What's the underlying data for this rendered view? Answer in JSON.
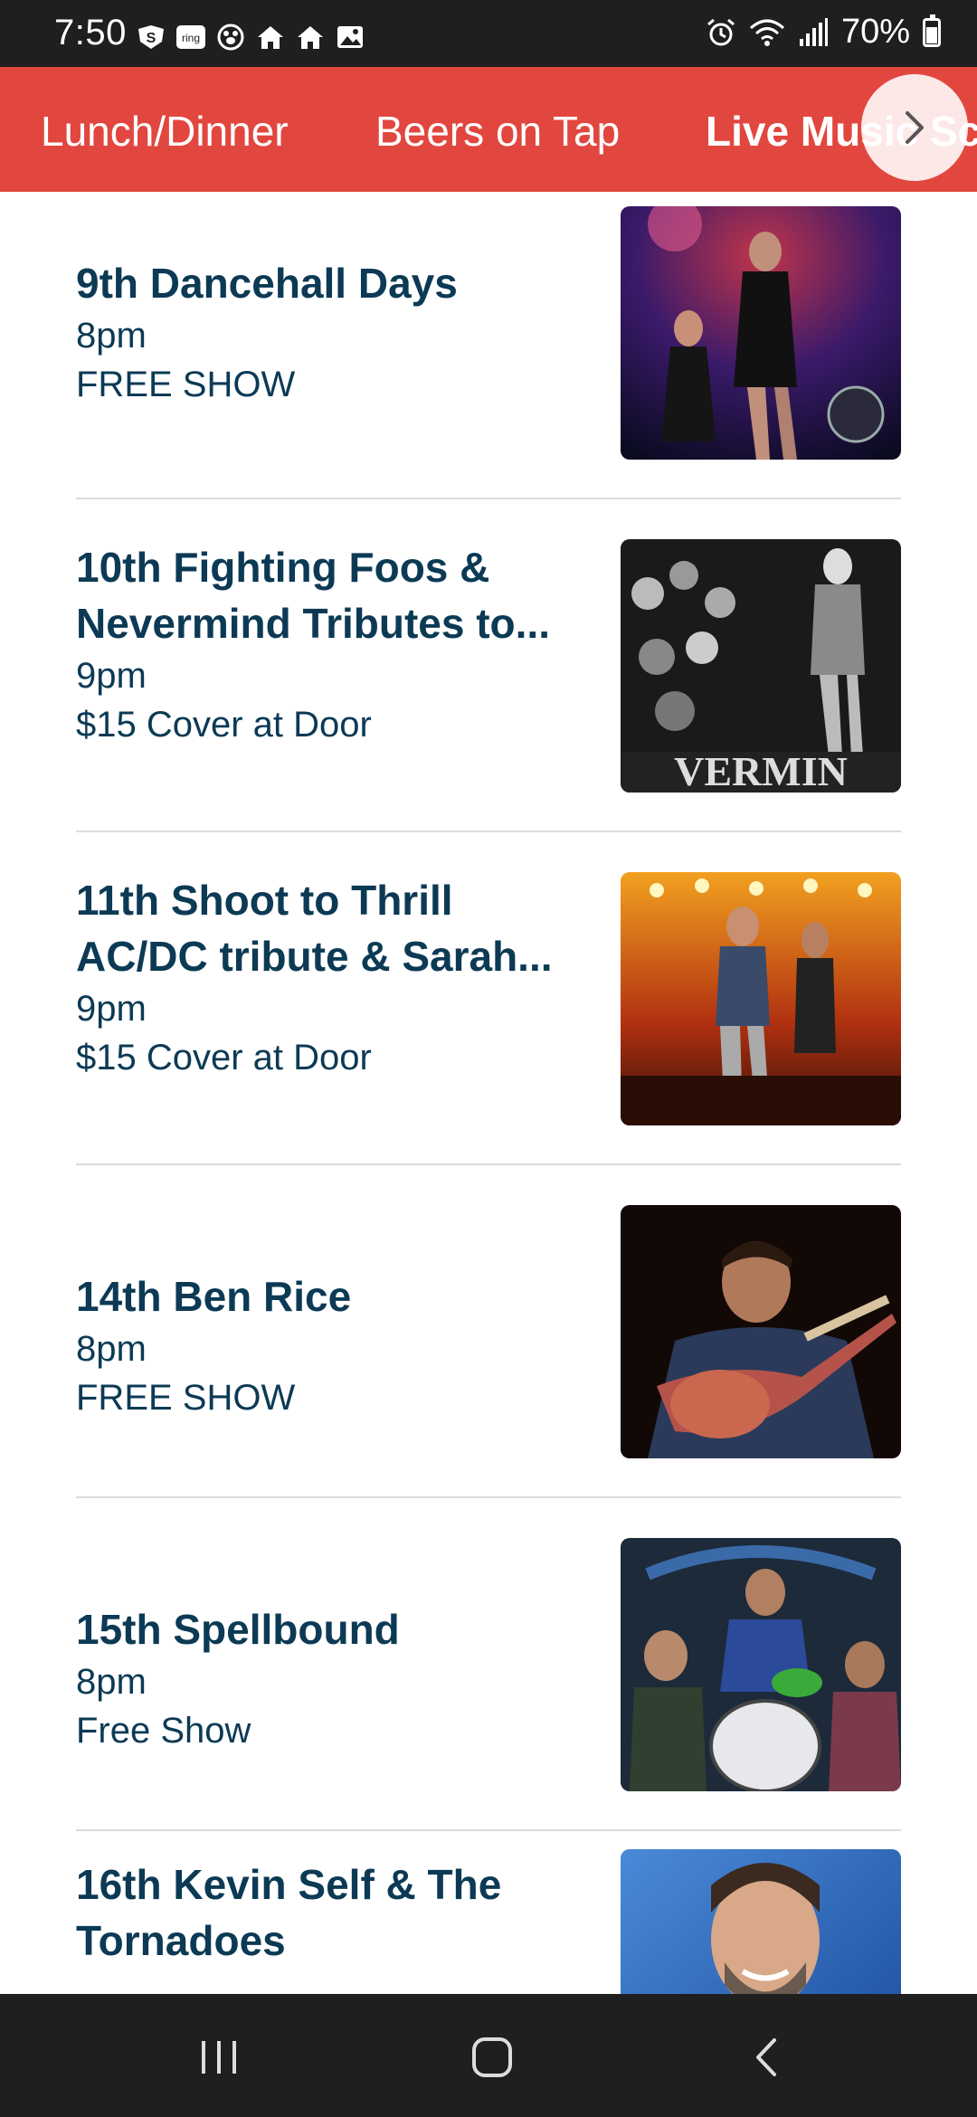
{
  "status": {
    "time": "7:50",
    "battery": "70%",
    "left_icons": [
      "s-shield-icon",
      "ring-icon",
      "paw-icon",
      "home-icon",
      "home-icon",
      "image-icon"
    ],
    "right_icons": [
      "alarm-icon",
      "wifi-icon",
      "signal-icon",
      "battery-icon"
    ]
  },
  "tabs": [
    {
      "label": "Lunch/Dinner"
    },
    {
      "label": "Beers on Tap"
    },
    {
      "label": "Live Music Sch"
    }
  ],
  "tabs_next_icon": "chevron-right-icon",
  "events": [
    {
      "title": "9th Dancehall Days",
      "time": "8pm",
      "price": "FREE SHOW"
    },
    {
      "title": "10th Fighting Foos & Nevermind Tributes to...",
      "time": "9pm",
      "price": "$15 Cover at Door"
    },
    {
      "title": "11th Shoot to Thrill AC/DC tribute & Sarah...",
      "time": "9pm",
      "price": "$15 Cover at Door"
    },
    {
      "title": "14th Ben Rice",
      "time": "8pm",
      "price": "FREE SHOW"
    },
    {
      "title": "15th Spellbound",
      "time": "8pm",
      "price": "Free Show"
    },
    {
      "title": "16th Kevin Self & The Tornadoes",
      "time": "",
      "price": ""
    }
  ],
  "photo_caption": "VERMIN",
  "nav": [
    "recent-apps-icon",
    "home-icon",
    "back-icon"
  ],
  "colors": {
    "accent": "#e1473f",
    "text": "#0c3a55",
    "bars": "#1f1f1f"
  }
}
